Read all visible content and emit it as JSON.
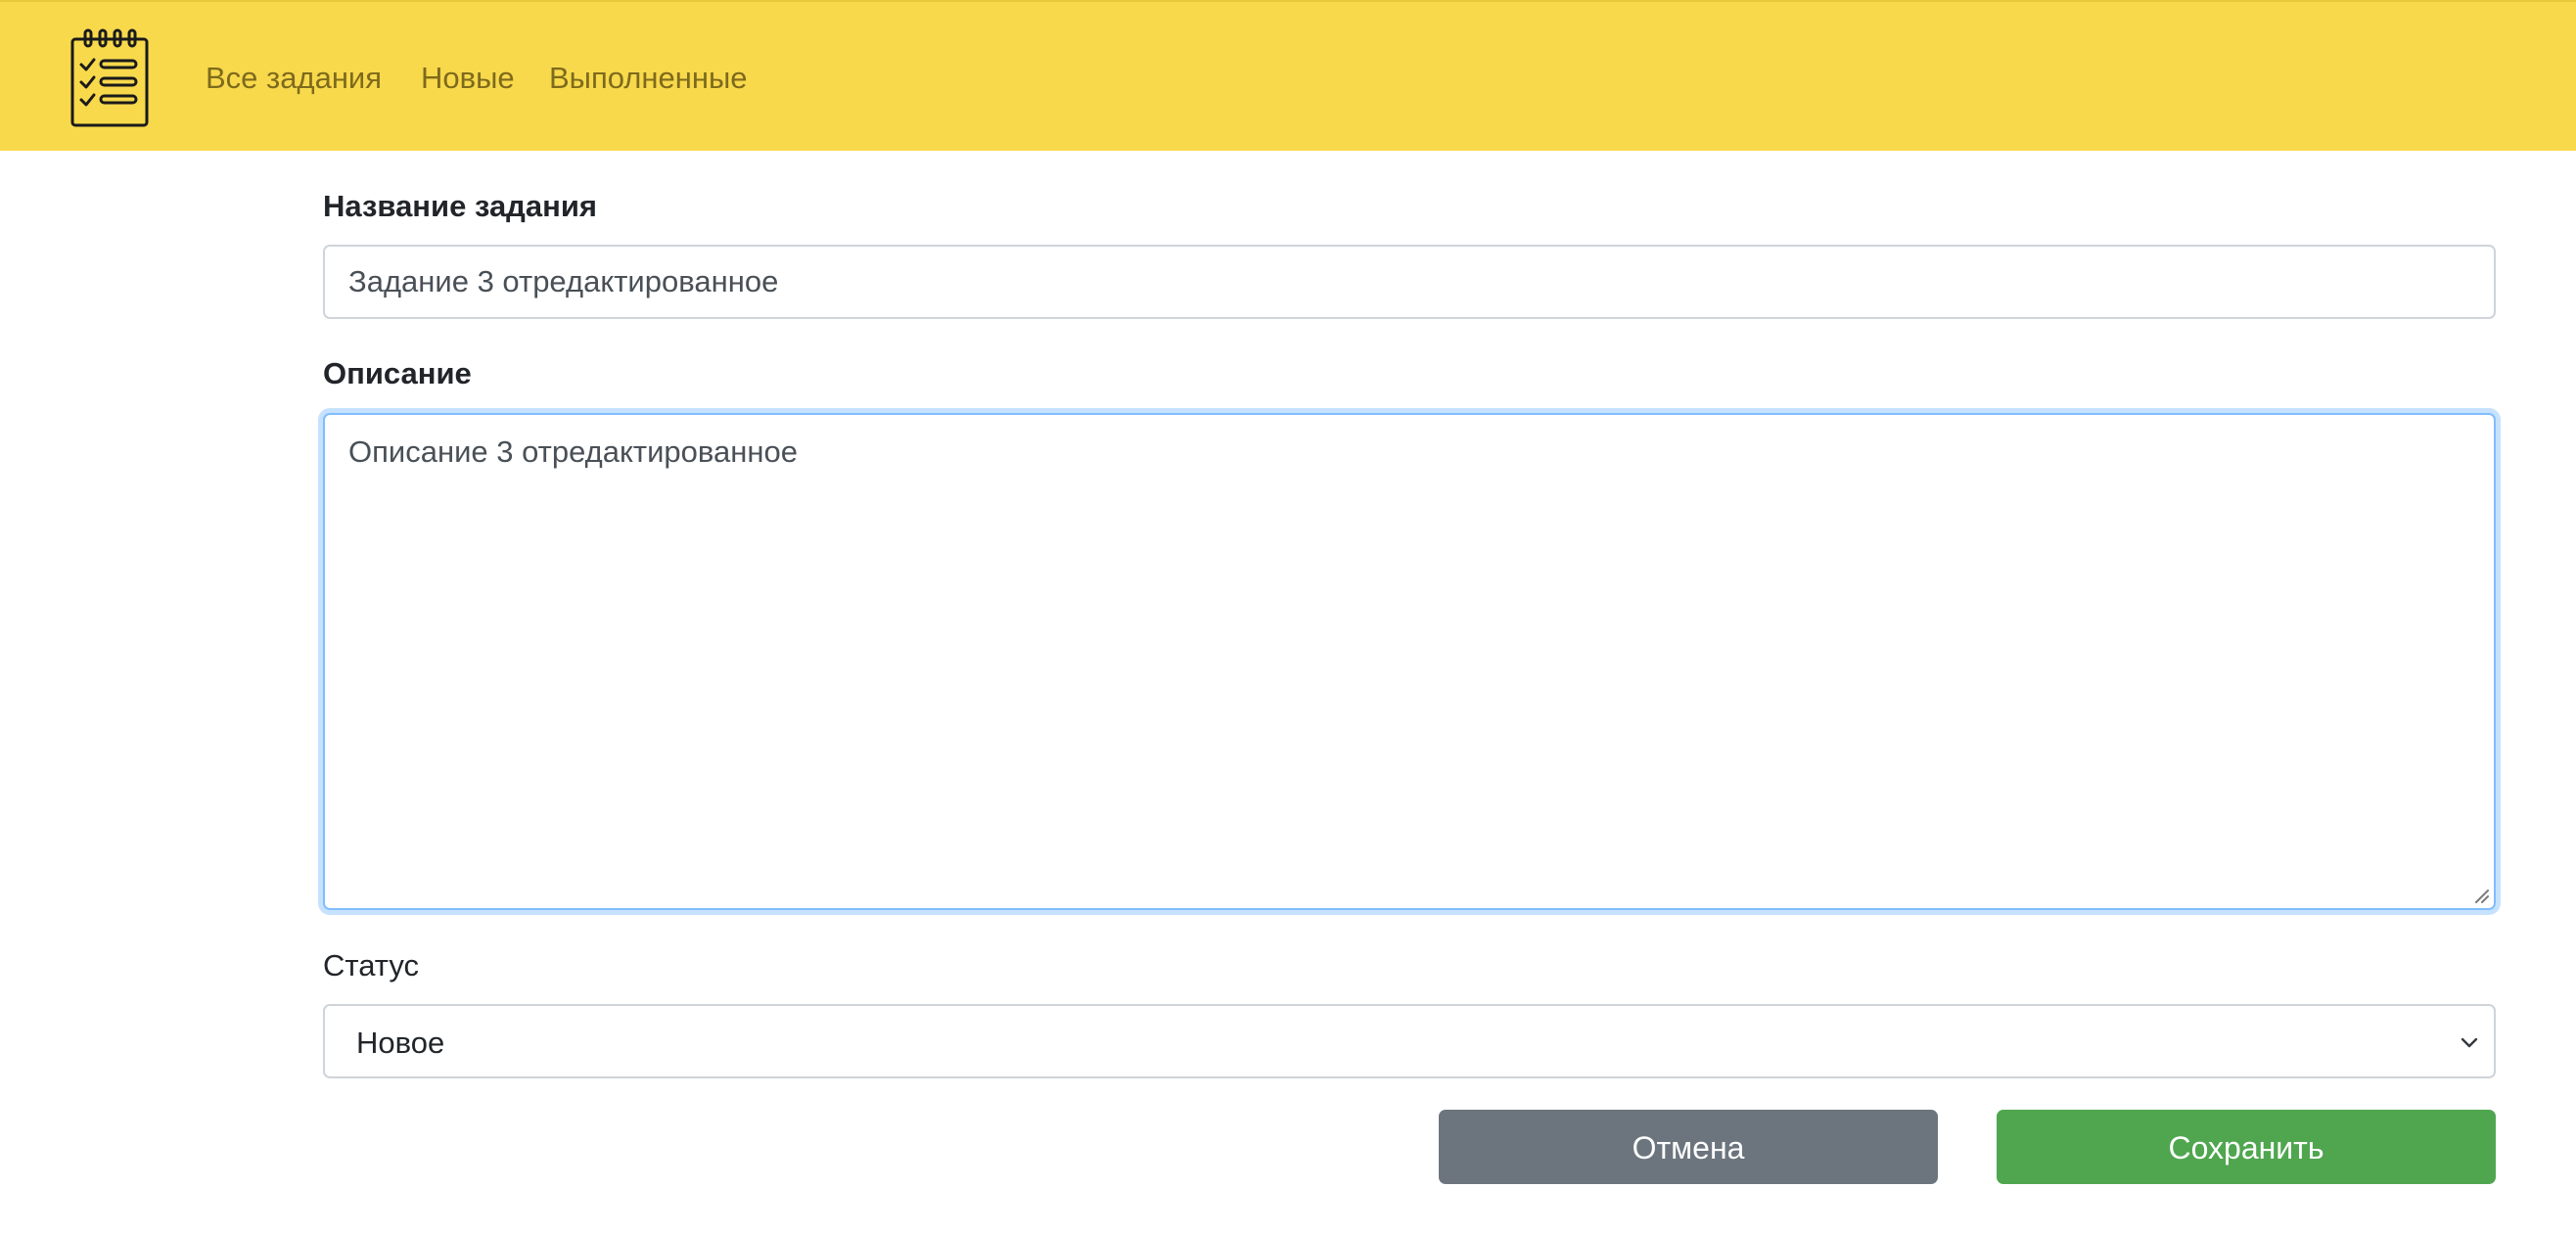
{
  "navbar": {
    "logo_icon": "checklist-icon",
    "links": [
      {
        "label": "Все задания"
      },
      {
        "label": "Новые"
      },
      {
        "label": "Выполненные"
      }
    ],
    "background_color": "#f8d94c",
    "link_color": "#7e6a1c"
  },
  "form": {
    "title_label": "Название задания",
    "title_value": "Задание 3 отредактированное",
    "description_label": "Описание",
    "description_value": "Описание 3 отредактированное",
    "status_label": "Статус",
    "status_value": "Новое",
    "cancel_label": "Отмена",
    "save_label": "Сохранить"
  },
  "colors": {
    "cancel_button": "#6c757d",
    "save_button": "#4fa64f",
    "focus_border": "#80bdff"
  }
}
